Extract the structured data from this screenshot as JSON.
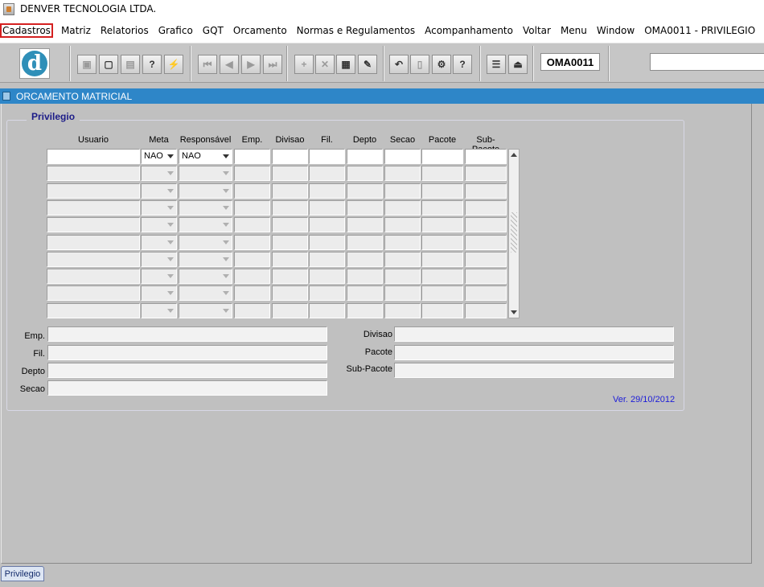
{
  "app": {
    "title": "DENVER TECNOLOGIA LTDA."
  },
  "menu": [
    {
      "label": "Cadastros"
    },
    {
      "label": "Matriz"
    },
    {
      "label": "Relatorios"
    },
    {
      "label": "Grafico"
    },
    {
      "label": "GQT"
    },
    {
      "label": "Orcamento"
    },
    {
      "label": "Normas e Regulamentos"
    },
    {
      "label": "Acompanhamento"
    },
    {
      "label": "Voltar"
    },
    {
      "label": "Menu"
    },
    {
      "label": "Window"
    },
    {
      "label": "OMA0011 - PRIVILEGIO"
    }
  ],
  "toolbar": {
    "logo_letter": "d",
    "form_code": "OMA0011",
    "search_value": "",
    "buttons": [
      {
        "name": "save-button",
        "glyph": "▣",
        "disabled": true
      },
      {
        "name": "window-button",
        "glyph": "▢",
        "disabled": false
      },
      {
        "name": "print-button",
        "glyph": "▤",
        "disabled": true
      },
      {
        "name": "query-help-button",
        "glyph": "?",
        "disabled": false
      },
      {
        "name": "execute-query-button",
        "glyph": "⚡",
        "disabled": false
      },
      {
        "name": "first-record-button",
        "glyph": "⏮",
        "disabled": true
      },
      {
        "name": "previous-record-button",
        "glyph": "◀",
        "disabled": true
      },
      {
        "name": "next-record-button",
        "glyph": "▶",
        "disabled": true
      },
      {
        "name": "last-record-button",
        "glyph": "⏭",
        "disabled": true
      },
      {
        "name": "insert-record-button",
        "glyph": "+",
        "disabled": true
      },
      {
        "name": "delete-record-button",
        "glyph": "✕",
        "disabled": true
      },
      {
        "name": "clear-form-button",
        "glyph": "▦",
        "disabled": false
      },
      {
        "name": "edit-button",
        "glyph": "✎",
        "disabled": false
      },
      {
        "name": "undo-button",
        "glyph": "↶",
        "disabled": false
      },
      {
        "name": "clipboard-button",
        "glyph": "▯",
        "disabled": true
      },
      {
        "name": "tools-button",
        "glyph": "⚙",
        "disabled": false
      },
      {
        "name": "help-button",
        "glyph": "?",
        "disabled": false
      },
      {
        "name": "menu-button",
        "glyph": "☰",
        "disabled": false
      },
      {
        "name": "exit-button",
        "glyph": "⏏",
        "disabled": false
      }
    ]
  },
  "window": {
    "title": "ORCAMENTO MATRICIAL"
  },
  "group": {
    "title": "Privilegio"
  },
  "grid": {
    "columns": [
      "Usuario",
      "Meta",
      "Responsável",
      "Emp.",
      "Divisao",
      "Fil.",
      "Depto",
      "Secao",
      "Pacote",
      "Sub-Pacote"
    ],
    "rows": [
      {
        "usuario": "",
        "meta": "NAO",
        "responsavel": "NAO",
        "emp": "",
        "divisao": "",
        "fil": "",
        "depto": "",
        "secao": "",
        "pacote": "",
        "subpacote": ""
      },
      {
        "usuario": "",
        "meta": "",
        "responsavel": "",
        "emp": "",
        "divisao": "",
        "fil": "",
        "depto": "",
        "secao": "",
        "pacote": "",
        "subpacote": ""
      },
      {
        "usuario": "",
        "meta": "",
        "responsavel": "",
        "emp": "",
        "divisao": "",
        "fil": "",
        "depto": "",
        "secao": "",
        "pacote": "",
        "subpacote": ""
      },
      {
        "usuario": "",
        "meta": "",
        "responsavel": "",
        "emp": "",
        "divisao": "",
        "fil": "",
        "depto": "",
        "secao": "",
        "pacote": "",
        "subpacote": ""
      },
      {
        "usuario": "",
        "meta": "",
        "responsavel": "",
        "emp": "",
        "divisao": "",
        "fil": "",
        "depto": "",
        "secao": "",
        "pacote": "",
        "subpacote": ""
      },
      {
        "usuario": "",
        "meta": "",
        "responsavel": "",
        "emp": "",
        "divisao": "",
        "fil": "",
        "depto": "",
        "secao": "",
        "pacote": "",
        "subpacote": ""
      },
      {
        "usuario": "",
        "meta": "",
        "responsavel": "",
        "emp": "",
        "divisao": "",
        "fil": "",
        "depto": "",
        "secao": "",
        "pacote": "",
        "subpacote": ""
      },
      {
        "usuario": "",
        "meta": "",
        "responsavel": "",
        "emp": "",
        "divisao": "",
        "fil": "",
        "depto": "",
        "secao": "",
        "pacote": "",
        "subpacote": ""
      },
      {
        "usuario": "",
        "meta": "",
        "responsavel": "",
        "emp": "",
        "divisao": "",
        "fil": "",
        "depto": "",
        "secao": "",
        "pacote": "",
        "subpacote": ""
      },
      {
        "usuario": "",
        "meta": "",
        "responsavel": "",
        "emp": "",
        "divisao": "",
        "fil": "",
        "depto": "",
        "secao": "",
        "pacote": "",
        "subpacote": ""
      }
    ]
  },
  "detail_left": [
    {
      "label": "Emp.",
      "value": ""
    },
    {
      "label": "Fil.",
      "value": ""
    },
    {
      "label": "Depto",
      "value": ""
    },
    {
      "label": "Secao",
      "value": ""
    }
  ],
  "detail_right": [
    {
      "label": "Divisao",
      "value": ""
    },
    {
      "label": "Pacote",
      "value": ""
    },
    {
      "label": "Sub-Pacote",
      "value": ""
    }
  ],
  "version": "Ver. 29/10/2012",
  "bottom_tab": {
    "label": "Privilegio"
  }
}
